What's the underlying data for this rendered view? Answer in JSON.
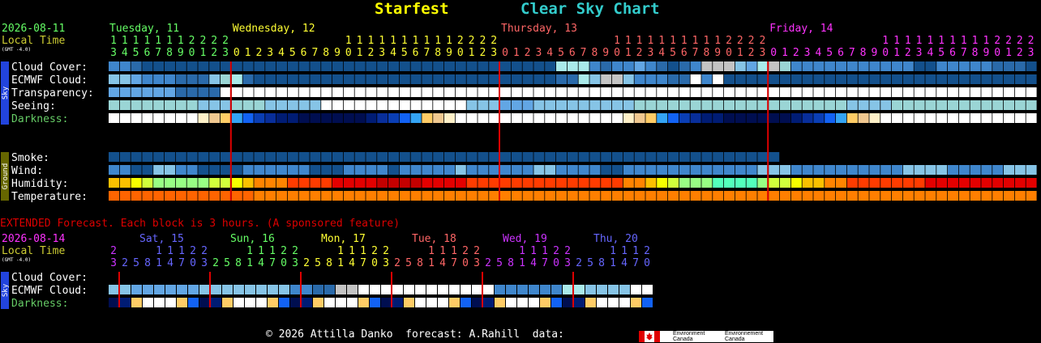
{
  "header": {
    "title_left": "Starfest",
    "title_right": "Clear Sky Chart"
  },
  "top": {
    "date": "2026-08-11",
    "local_time": "Local Time",
    "gmt": "(GMT -4.0)",
    "day_labels": [
      {
        "text": "Tuesday, 11",
        "color": "#66ff66"
      },
      {
        "text": "Wednesday, 12",
        "color": "#ffff33"
      },
      {
        "text": "Thursday, 13",
        "color": "#ff6666"
      },
      {
        "text": "Friday, 14",
        "color": "#ff33ff"
      }
    ],
    "hour_start": 13,
    "hour_count": 83,
    "sky_rows": [
      "Cloud Cover:",
      "ECMWF Cloud:",
      "Transparency:",
      "Seeing:",
      "Darkness:"
    ],
    "ground_rows": [
      "Smoke:",
      "Wind:",
      "Humidity:",
      "Temperature:"
    ],
    "sky_tab": "Sky",
    "ground_tab": "Ground"
  },
  "extended": {
    "heading": "EXTENDED Forecast. Each block is 3 hours. (A sponsored feature)",
    "date": "2026-08-14",
    "local_time": "Local Time",
    "gmt": "(GMT -4.0)",
    "day_labels": [
      {
        "text": "Sat, 15",
        "color": "#6666ff"
      },
      {
        "text": "Sun, 16",
        "color": "#66ff66"
      },
      {
        "text": "Mon, 17",
        "color": "#ffff33"
      },
      {
        "text": "Tue, 18",
        "color": "#ff6666"
      },
      {
        "text": "Wed, 19",
        "color": "#cc33ff"
      },
      {
        "text": "Thu, 20",
        "color": "#6666ff"
      }
    ],
    "hours": [
      23,
      2,
      5,
      8,
      11,
      14,
      17,
      20,
      23,
      2,
      5,
      8,
      11,
      14,
      17,
      20,
      23,
      2,
      5,
      8,
      11,
      14,
      17,
      20,
      23,
      2,
      5,
      8,
      11,
      14,
      17,
      20,
      23,
      2,
      5,
      8,
      11,
      14,
      17,
      20,
      23,
      2,
      5,
      8,
      11,
      14,
      17,
      20
    ],
    "rows": [
      "Cloud Cover:",
      "ECMWF Cloud:",
      "Darkness:"
    ],
    "sky_tab": "Sky"
  },
  "footer": {
    "text": "© 2026 Attilla Danko  forecast: A.Rahill  data:",
    "logo_en": "Environment\nCanada",
    "logo_fr": "Environnement\nCanada"
  },
  "chart_data": {
    "type": "heatmap",
    "title": "Clear Sky Chart",
    "subtitle": "Starfest",
    "hourly_start": "2026-08-11 13:00 local",
    "hourly_step_hours": 1,
    "extended_step_hours": 3,
    "palette": {
      "cloud_cover_pct": {
        "0": "#ffffff",
        "10": "#ffffff",
        "20": "#dddddd",
        "30": "#c4c4c4",
        "40": "#aaeaea",
        "50": "#9ad5d5",
        "60": "#86c4e6",
        "70": "#62a6e4",
        "80": "#3f86cc",
        "90": "#2a6aaa",
        "100": "#13508c"
      },
      "transparency": {
        "too_cloudy": "#ffffff",
        "poor": "#9ad5d5",
        "below_average": "#86c4e6",
        "average": "#62a6e4",
        "above_average": "#2a6aaa",
        "transparent": "#13508c"
      },
      "seeing": {
        "too_cloudy": "#ffffff",
        "bad_1_5": "#9ad5d5",
        "poor_2_5": "#86c4e6",
        "average_3_5": "#62a6e4"
      },
      "darkness_mag": {
        "day": "#ffffff",
        "twilight_low": "#fff0c8",
        "twilight": "#f0c890",
        "civil": "#ffcc66",
        "-2": "#34a4f4",
        "-1": "#1262f4",
        "4": "#0a3eb4",
        "5": "#082e9a",
        "6": "#001c74",
        "7": "#000e50"
      },
      "humidity_pct": {
        "25": "#08feed",
        "30": "#53ffbc",
        "40": "#98fe84",
        "45": "#d0ff3c",
        "55": "#f6ff00",
        "65": "#fac000",
        "70": "#ff8400",
        "80": "#ff3c00",
        "90": "#e30000",
        "95": "#c40000"
      },
      "temperature": {
        "18": "#ff4000",
        "20": "#ff6400",
        "22": "#ff7f00",
        "24": "#ff9000",
        "26": "#ffa100",
        "28": "#ffb000"
      }
    },
    "cloud_cover": [
      80,
      80,
      90,
      100,
      100,
      100,
      100,
      100,
      100,
      100,
      100,
      100,
      100,
      100,
      100,
      100,
      100,
      100,
      100,
      100,
      100,
      100,
      100,
      100,
      100,
      100,
      100,
      100,
      100,
      100,
      100,
      100,
      100,
      100,
      100,
      100,
      100,
      100,
      100,
      100,
      40,
      40,
      40,
      80,
      90,
      80,
      80,
      70,
      80,
      90,
      100,
      90,
      80,
      30,
      30,
      30,
      60,
      70,
      40,
      30,
      50,
      80,
      80,
      80,
      80,
      80,
      80,
      80,
      80,
      80,
      80,
      80,
      100,
      100,
      80,
      80,
      80,
      80,
      80,
      90,
      90,
      90,
      100,
      100,
      100,
      100,
      100,
      100,
      100
    ],
    "ecmwf_cloud": [
      60,
      60,
      70,
      80,
      80,
      80,
      90,
      90,
      90,
      60,
      50,
      40,
      90,
      100,
      100,
      100,
      100,
      100,
      100,
      100,
      100,
      100,
      100,
      100,
      100,
      100,
      100,
      100,
      100,
      100,
      100,
      100,
      100,
      100,
      100,
      100,
      100,
      100,
      100,
      100,
      90,
      90,
      40,
      60,
      30,
      30,
      60,
      80,
      80,
      80,
      90,
      90,
      0,
      80,
      0,
      100,
      100,
      100,
      100,
      100,
      100,
      100,
      100,
      100,
      100,
      100,
      100,
      100,
      100,
      100,
      100,
      100,
      100,
      100,
      100,
      100,
      100,
      100,
      100,
      100,
      100,
      100,
      100,
      100,
      100,
      100,
      100,
      100,
      100
    ],
    "transparency": [
      "average",
      "average",
      "average",
      "average",
      "average",
      "average",
      "above_average",
      "above_average",
      "above_average",
      "above_average",
      "too_cloudy",
      "too_cloudy",
      "too_cloudy",
      "too_cloudy",
      "too_cloudy",
      "too_cloudy",
      "too_cloudy",
      "too_cloudy",
      "too_cloudy",
      "too_cloudy",
      "too_cloudy",
      "too_cloudy",
      "too_cloudy",
      "too_cloudy",
      "too_cloudy",
      "too_cloudy",
      "too_cloudy",
      "too_cloudy",
      "too_cloudy",
      "too_cloudy",
      "too_cloudy",
      "too_cloudy",
      "too_cloudy",
      "too_cloudy",
      "too_cloudy",
      "too_cloudy",
      "too_cloudy",
      "too_cloudy",
      "too_cloudy",
      "too_cloudy",
      "too_cloudy",
      "too_cloudy",
      "too_cloudy",
      "too_cloudy",
      "too_cloudy",
      "too_cloudy",
      "too_cloudy",
      "too_cloudy",
      "too_cloudy",
      "too_cloudy",
      "too_cloudy",
      "too_cloudy",
      "too_cloudy",
      "too_cloudy",
      "too_cloudy",
      "too_cloudy",
      "too_cloudy",
      "too_cloudy",
      "too_cloudy",
      "too_cloudy",
      "too_cloudy",
      "too_cloudy",
      "too_cloudy",
      "too_cloudy",
      "too_cloudy",
      "too_cloudy",
      "too_cloudy",
      "too_cloudy",
      "too_cloudy",
      "too_cloudy",
      "too_cloudy",
      "too_cloudy",
      "too_cloudy",
      "too_cloudy",
      "too_cloudy",
      "too_cloudy",
      "too_cloudy",
      "too_cloudy",
      "too_cloudy",
      "too_cloudy",
      "too_cloudy",
      "too_cloudy",
      "too_cloudy"
    ],
    "seeing": [
      "bad_1_5",
      "bad_1_5",
      "bad_1_5",
      "bad_1_5",
      "bad_1_5",
      "bad_1_5",
      "bad_1_5",
      "bad_1_5",
      "poor_2_5",
      "poor_2_5",
      "poor_2_5",
      "bad_1_5",
      "bad_1_5",
      "bad_1_5",
      "poor_2_5",
      "poor_2_5",
      "poor_2_5",
      "poor_2_5",
      "poor_2_5",
      "too_cloudy",
      "too_cloudy",
      "too_cloudy",
      "too_cloudy",
      "too_cloudy",
      "too_cloudy",
      "too_cloudy",
      "too_cloudy",
      "too_cloudy",
      "too_cloudy",
      "too_cloudy",
      "too_cloudy",
      "too_cloudy",
      "poor_2_5",
      "poor_2_5",
      "poor_2_5",
      "average_3_5",
      "average_3_5",
      "average_3_5",
      "poor_2_5",
      "poor_2_5",
      "poor_2_5",
      "poor_2_5",
      "poor_2_5",
      "poor_2_5",
      "poor_2_5",
      "poor_2_5",
      "poor_2_5",
      "bad_1_5",
      "bad_1_5",
      "bad_1_5",
      "bad_1_5",
      "bad_1_5",
      "bad_1_5",
      "bad_1_5",
      "bad_1_5",
      "bad_1_5",
      "bad_1_5",
      "bad_1_5",
      "bad_1_5",
      "bad_1_5",
      "bad_1_5",
      "bad_1_5",
      "bad_1_5",
      "bad_1_5",
      "bad_1_5",
      "bad_1_5",
      "poor_2_5",
      "poor_2_5",
      "poor_2_5",
      "poor_2_5",
      "bad_1_5",
      "bad_1_5",
      "bad_1_5",
      "bad_1_5",
      "bad_1_5",
      "bad_1_5",
      "bad_1_5",
      "bad_1_5",
      "bad_1_5",
      "bad_1_5",
      "bad_1_5",
      "bad_1_5",
      "bad_1_5"
    ],
    "darkness": [
      "day",
      "day",
      "day",
      "day",
      "day",
      "day",
      "day",
      "day",
      "twilight_low",
      "twilight",
      "civil",
      "-2",
      "-1",
      "4",
      "5",
      "6",
      "6",
      "7",
      "7",
      "7",
      "7",
      "7",
      "7",
      "6",
      "5",
      "4",
      "-1",
      "-2",
      "civil",
      "twilight",
      "twilight_low",
      "day",
      "day",
      "day",
      "day",
      "day",
      "day",
      "day",
      "day",
      "day",
      "day",
      "day",
      "day",
      "day",
      "day",
      "day",
      "twilight_low",
      "twilight",
      "civil",
      "-2",
      "-1",
      "4",
      "5",
      "6",
      "6",
      "7",
      "7",
      "7",
      "7",
      "7",
      "7",
      "6",
      "5",
      "4",
      "-1",
      "-2",
      "civil",
      "twilight",
      "twilight_low",
      "day",
      "day",
      "day",
      "day",
      "day",
      "day",
      "day",
      "day",
      "day",
      "day",
      "day",
      "day",
      "day",
      "day"
    ],
    "smoke": [
      0,
      0,
      0,
      0,
      0,
      0,
      0,
      0,
      0,
      0,
      0,
      0,
      0,
      0,
      0,
      0,
      0,
      0,
      0,
      0,
      0,
      0,
      0,
      0,
      0,
      0,
      0,
      0,
      0,
      0,
      0,
      0,
      0,
      0,
      0,
      0,
      0,
      0,
      0,
      0,
      0,
      0,
      0,
      0,
      0,
      0,
      0,
      0,
      0,
      0,
      0,
      0,
      0,
      0,
      0,
      0,
      0,
      0,
      0,
      0
    ],
    "wind": [
      1,
      1,
      0,
      0,
      2,
      2,
      1,
      1,
      0,
      0,
      0,
      0,
      1,
      1,
      1,
      1,
      1,
      1,
      0,
      0,
      0,
      1,
      1,
      1,
      1,
      0,
      1,
      1,
      1,
      1,
      1,
      2,
      1,
      1,
      1,
      1,
      1,
      1,
      2,
      2,
      1,
      1,
      1,
      1,
      0,
      0,
      1,
      1,
      1,
      1,
      1,
      1,
      1,
      1,
      1,
      1,
      1,
      1,
      2,
      2,
      2,
      1,
      1,
      1,
      1,
      1,
      1,
      1,
      1,
      1,
      1,
      2,
      2,
      2,
      2,
      1,
      1,
      1,
      1,
      1,
      2,
      2,
      2
    ],
    "humidity": [
      65,
      65,
      55,
      45,
      40,
      40,
      40,
      40,
      40,
      45,
      45,
      55,
      65,
      70,
      70,
      70,
      80,
      80,
      80,
      80,
      90,
      90,
      90,
      90,
      95,
      95,
      95,
      95,
      90,
      90,
      90,
      90,
      80,
      80,
      80,
      80,
      80,
      80,
      80,
      80,
      80,
      80,
      80,
      80,
      80,
      80,
      70,
      70,
      65,
      55,
      45,
      40,
      40,
      40,
      30,
      30,
      30,
      30,
      40,
      45,
      45,
      55,
      65,
      65,
      70,
      70,
      80,
      80,
      80,
      80,
      80,
      80,
      80,
      90,
      90,
      90,
      90,
      90,
      90,
      90,
      90,
      90,
      90
    ],
    "temperature": [
      20,
      20,
      20,
      20,
      20,
      20,
      20,
      20,
      20,
      20,
      20,
      20,
      20,
      22,
      22,
      22,
      22,
      22,
      22,
      22,
      22,
      22,
      22,
      22,
      22,
      22,
      22,
      22,
      22,
      22,
      22,
      22,
      22,
      22,
      22,
      22,
      22,
      22,
      22,
      22,
      22,
      22,
      22,
      22,
      22,
      22,
      22,
      22,
      22,
      22,
      22,
      22,
      22,
      22,
      22,
      22,
      22,
      22,
      22,
      22,
      22,
      22,
      22,
      22,
      22,
      22,
      22,
      22,
      22,
      22,
      22,
      22,
      22,
      22,
      22,
      22,
      22,
      22,
      22,
      22,
      22,
      22,
      22
    ],
    "extended_cloud_cover": [
      60,
      70,
      60,
      60,
      60,
      70,
      70,
      80,
      80,
      80,
      30,
      0,
      0,
      0,
      0,
      0,
      0,
      0,
      0,
      0,
      0,
      0,
      0,
      0
    ],
    "extended_ecmwf_cloud": [
      60,
      70,
      70,
      70,
      60,
      60,
      60,
      60,
      80,
      90,
      30,
      0,
      0,
      0,
      0,
      0,
      0,
      80,
      80,
      80,
      40,
      60,
      60,
      0
    ],
    "extended_darkness": [
      "7",
      "6",
      "civil",
      "day",
      "day",
      "day",
      "civil",
      "-1",
      "7",
      "6",
      "civil",
      "day",
      "day",
      "day",
      "civil",
      "-1",
      "7",
      "6",
      "civil",
      "day",
      "day",
      "day",
      "civil",
      "-1",
      "7",
      "6",
      "civil",
      "day",
      "day",
      "day",
      "civil",
      "-1",
      "7",
      "6",
      "civil",
      "day",
      "day",
      "day",
      "civil",
      "-1",
      "7",
      "6",
      "civil",
      "day",
      "day",
      "day",
      "civil",
      "-1"
    ]
  }
}
